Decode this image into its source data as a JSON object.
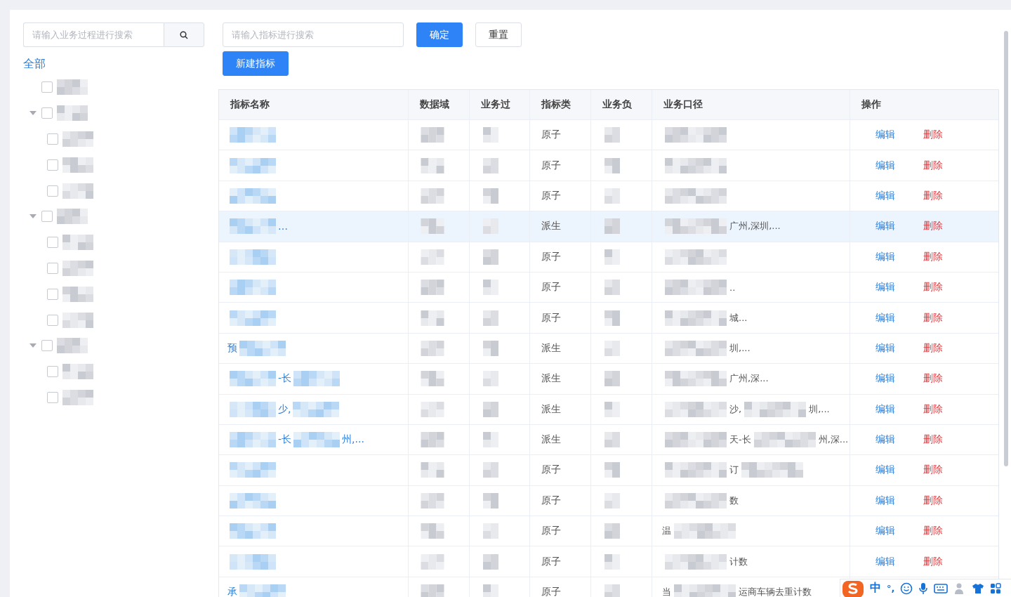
{
  "sidebar": {
    "search": {
      "placeholder": "请输入业务过程进行搜索"
    },
    "all_label": "全部",
    "tree": [
      {
        "checked": false
      },
      {
        "checked": false,
        "expanded": true,
        "children": [
          {
            "checked": false
          },
          {
            "checked": false
          },
          {
            "checked": false
          }
        ]
      },
      {
        "checked": false,
        "expanded": true,
        "children": [
          {
            "checked": false
          },
          {
            "checked": false
          },
          {
            "checked": false
          },
          {
            "checked": false
          }
        ]
      },
      {
        "checked": false,
        "expanded": true,
        "children": [
          {
            "checked": false
          },
          {
            "checked": false
          }
        ]
      }
    ]
  },
  "toolbar": {
    "search": {
      "placeholder": "请输入指标进行搜索"
    },
    "confirm": "确定",
    "reset": "重置",
    "create": "新建指标"
  },
  "table": {
    "columns": [
      "指标名称",
      "数据域",
      "业务过",
      "指标类",
      "业务负",
      "业务口径",
      "操作"
    ],
    "rows": [
      {
        "name": [
          {
            "kind": "blur"
          }
        ],
        "type": "原子",
        "caliber": [
          {
            "kind": "blur"
          }
        ],
        "edit": "编辑",
        "delete": "删除",
        "selected": false
      },
      {
        "name": [
          {
            "kind": "blur"
          }
        ],
        "type": "原子",
        "caliber": [
          {
            "kind": "blur"
          }
        ],
        "edit": "编辑",
        "delete": "删除",
        "selected": false
      },
      {
        "name": [
          {
            "kind": "blur"
          }
        ],
        "type": "原子",
        "caliber": [
          {
            "kind": "blur"
          }
        ],
        "edit": "编辑",
        "delete": "删除",
        "selected": false
      },
      {
        "name": [
          {
            "kind": "blur"
          },
          {
            "kind": "text",
            "text": "…"
          }
        ],
        "type": "派生",
        "caliber": [
          {
            "kind": "blur"
          },
          {
            "kind": "text",
            "text": "广州,深圳,..."
          }
        ],
        "edit": "编辑",
        "delete": "删除",
        "selected": true
      },
      {
        "name": [
          {
            "kind": "blur"
          }
        ],
        "type": "原子",
        "caliber": [
          {
            "kind": "blur"
          }
        ],
        "edit": "编辑",
        "delete": "删除",
        "selected": false
      },
      {
        "name": [
          {
            "kind": "blur"
          }
        ],
        "type": "原子",
        "caliber": [
          {
            "kind": "blur"
          },
          {
            "kind": "text",
            "text": ".."
          }
        ],
        "edit": "编辑",
        "delete": "删除",
        "selected": false
      },
      {
        "name": [
          {
            "kind": "blur"
          }
        ],
        "type": "原子",
        "caliber": [
          {
            "kind": "blur"
          },
          {
            "kind": "text",
            "text": "城..."
          }
        ],
        "edit": "编辑",
        "delete": "删除",
        "selected": false
      },
      {
        "name": [
          {
            "kind": "text",
            "text": "预"
          },
          {
            "kind": "blur"
          }
        ],
        "type": "派生",
        "caliber": [
          {
            "kind": "blur"
          },
          {
            "kind": "text",
            "text": "圳,..."
          }
        ],
        "edit": "编辑",
        "delete": "删除",
        "selected": false
      },
      {
        "name": [
          {
            "kind": "blur"
          },
          {
            "kind": "text",
            "text": "-长"
          },
          {
            "kind": "blur"
          }
        ],
        "type": "派生",
        "caliber": [
          {
            "kind": "blur"
          },
          {
            "kind": "text",
            "text": "广州,深..."
          }
        ],
        "edit": "编辑",
        "delete": "删除",
        "selected": false
      },
      {
        "name": [
          {
            "kind": "blur"
          },
          {
            "kind": "text",
            "text": "少,"
          },
          {
            "kind": "blur"
          }
        ],
        "type": "派生",
        "caliber": [
          {
            "kind": "blur"
          },
          {
            "kind": "text",
            "text": "沙,"
          },
          {
            "kind": "blur"
          },
          {
            "kind": "text",
            "text": "圳,..."
          }
        ],
        "edit": "编辑",
        "delete": "删除",
        "selected": false
      },
      {
        "name": [
          {
            "kind": "blur"
          },
          {
            "kind": "text",
            "text": "-长"
          },
          {
            "kind": "blur"
          },
          {
            "kind": "text",
            "text": "州,..."
          }
        ],
        "type": "派生",
        "caliber": [
          {
            "kind": "blur"
          },
          {
            "kind": "text",
            "text": "天-长"
          },
          {
            "kind": "blur"
          },
          {
            "kind": "text",
            "text": "州,深..."
          }
        ],
        "edit": "编辑",
        "delete": "删除",
        "selected": false
      },
      {
        "name": [
          {
            "kind": "blur"
          }
        ],
        "type": "原子",
        "caliber": [
          {
            "kind": "blur"
          },
          {
            "kind": "text",
            "text": "订"
          },
          {
            "kind": "blur"
          }
        ],
        "edit": "编辑",
        "delete": "删除",
        "selected": false
      },
      {
        "name": [
          {
            "kind": "blur"
          }
        ],
        "type": "原子",
        "caliber": [
          {
            "kind": "blur"
          },
          {
            "kind": "text",
            "text": "数"
          }
        ],
        "edit": "编辑",
        "delete": "删除",
        "selected": false
      },
      {
        "name": [
          {
            "kind": "blur"
          }
        ],
        "type": "原子",
        "caliber": [
          {
            "kind": "text",
            "text": "温"
          },
          {
            "kind": "blur"
          }
        ],
        "edit": "编辑",
        "delete": "删除",
        "selected": false
      },
      {
        "name": [
          {
            "kind": "blur"
          }
        ],
        "type": "原子",
        "caliber": [
          {
            "kind": "blur"
          },
          {
            "kind": "text",
            "text": "计数"
          }
        ],
        "edit": "编辑",
        "delete": "删除",
        "selected": false
      },
      {
        "name": [
          {
            "kind": "text",
            "text": "承"
          },
          {
            "kind": "blur"
          }
        ],
        "type": "原子",
        "caliber": [
          {
            "kind": "text",
            "text": "当"
          },
          {
            "kind": "blur"
          },
          {
            "kind": "text",
            "text": "运商车辆去重计数"
          }
        ],
        "selected": false
      }
    ]
  },
  "ime_toolbar": {
    "mode": "中",
    "punctuation": "°,"
  }
}
